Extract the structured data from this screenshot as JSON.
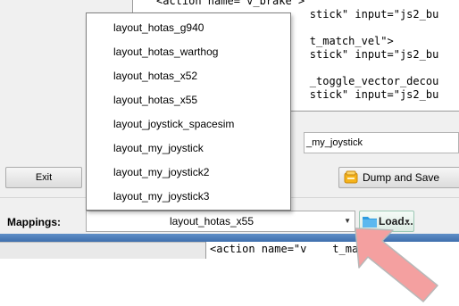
{
  "xml_editor": {
    "lines": [
      "<action name=\"v_brake\">",
      "        stick\" input=\"js2_bu",
      "",
      "        t_match_vel\">",
      "        stick\" input=\"js2_bu",
      "",
      "        _toggle_vector_decou",
      "        stick\" input=\"js2_bu"
    ]
  },
  "joystick_field": {
    "value": "_my_joystick"
  },
  "buttons": {
    "exit": "Exit",
    "dump_and_save": "Dump and Save",
    "load": "Load..."
  },
  "mappings": {
    "label": "Mappings:",
    "selected": "layout_hotas_x55",
    "options": [
      "layout_hotas_g940",
      "layout_hotas_warthog",
      "layout_hotas_x52",
      "layout_hotas_x55",
      "layout_joystick_spacesim",
      "layout_my_joystick",
      "layout_my_joystick2",
      "layout_my_joystick3"
    ]
  },
  "lower_editor": {
    "line": "<action name=\"v    t_match"
  },
  "colors": {
    "load_accent": "#2d9be0",
    "pointer_arrow": "#f4a0a0",
    "title_bar": "#4a7cbd"
  },
  "icons": {
    "dump": "help-icon",
    "load": "folder-icon",
    "dropdown": "chevron-down-icon",
    "pointer": "pointer-arrow-icon"
  }
}
